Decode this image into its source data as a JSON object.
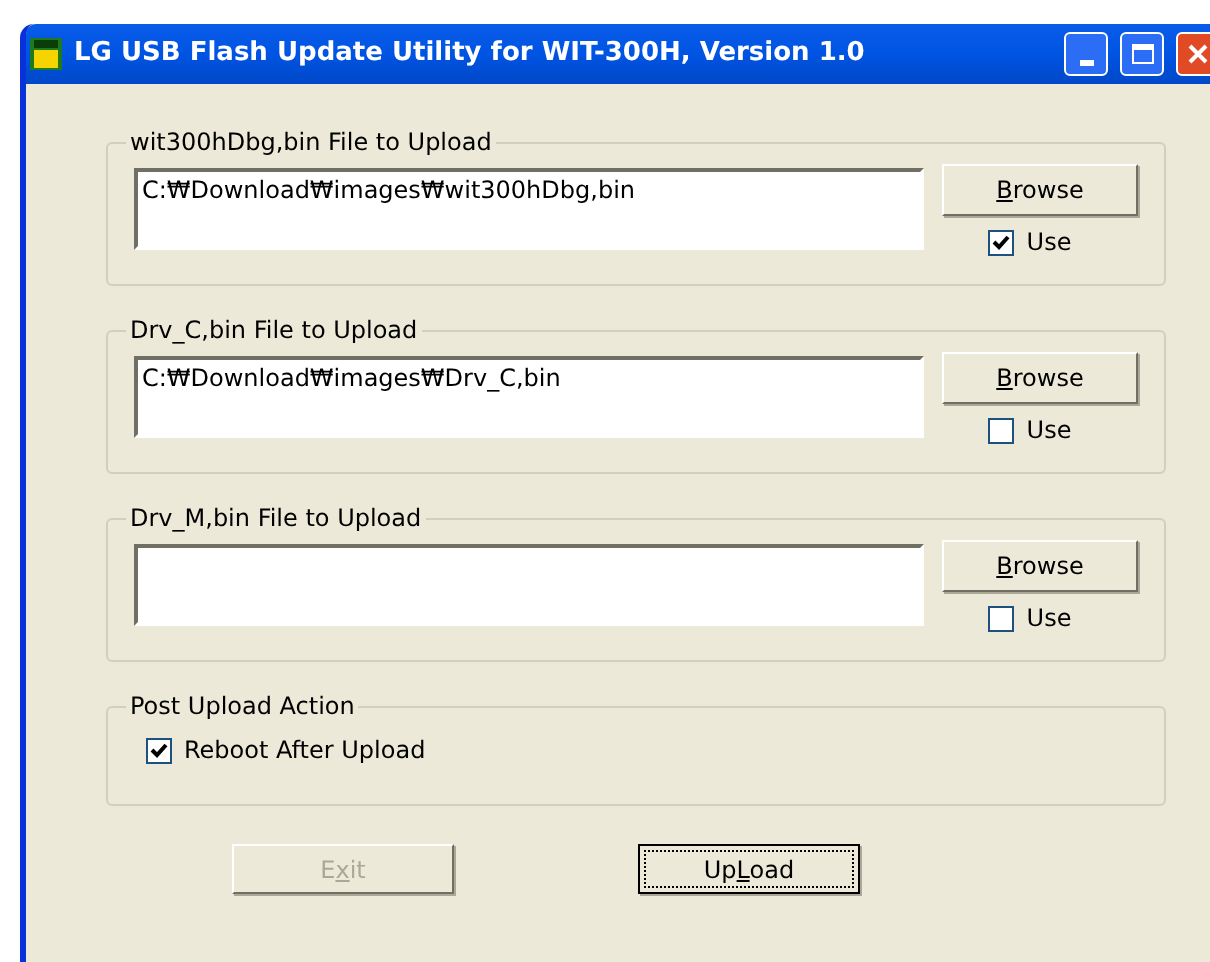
{
  "window": {
    "title": "LG USB Flash Update Utility for WIT-300H, Version 1.0"
  },
  "file_groups": [
    {
      "legend": "wit300hDbg,bin File to Upload",
      "path": "C:₩Download₩images₩wit300hDbg,bin",
      "browse": {
        "key": "B",
        "after": "rowse"
      },
      "use_label": "Use",
      "use_checked": true
    },
    {
      "legend": "Drv_C,bin File to Upload",
      "path": "C:₩Download₩images₩Drv_C,bin",
      "browse": {
        "key": "B",
        "after": "rowse"
      },
      "use_label": "Use",
      "use_checked": false
    },
    {
      "legend": "Drv_M,bin File to Upload",
      "browse": {
        "key": "B",
        "after": "rowse"
      },
      "use_label": "Use",
      "use_checked": false
    }
  ],
  "post_action": {
    "legend": "Post Upload Action",
    "option_label": "Reboot After Upload",
    "checked": true
  },
  "buttons": [
    {
      "before": "E",
      "key": "x",
      "after": "it",
      "disabled": true,
      "focused": false
    },
    {
      "before": "Up",
      "key": "L",
      "after": "oad",
      "disabled": false,
      "focused": true
    }
  ]
}
